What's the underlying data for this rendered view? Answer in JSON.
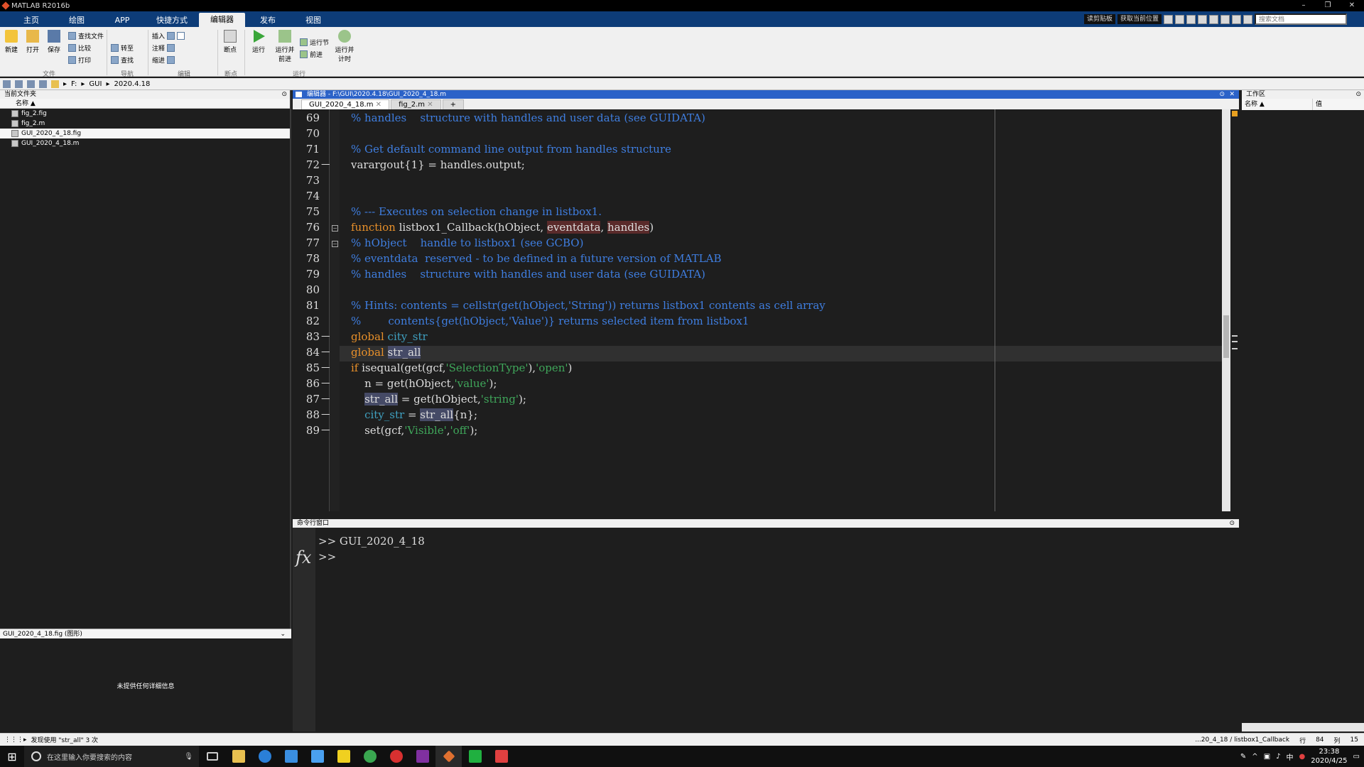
{
  "window": {
    "title": "MATLAB R2016b",
    "controls": [
      "–",
      "❐",
      "✕"
    ]
  },
  "ribbon_tabs": [
    {
      "label": "主页",
      "active": false
    },
    {
      "label": "绘图",
      "active": false
    },
    {
      "label": "APP",
      "active": false
    },
    {
      "label": "快捷方式",
      "active": false
    },
    {
      "label": "编辑器",
      "active": true
    },
    {
      "label": "发布",
      "active": false
    },
    {
      "label": "视图",
      "active": false
    }
  ],
  "quick_access": {
    "btn1": "读剪贴板",
    "btn2": "获取当前位置",
    "search_placeholder": "搜索文档"
  },
  "ribbon": {
    "new": "新建",
    "open": "打开",
    "save": "保存",
    "find_files": "查找文件",
    "compare": "比较",
    "print": "打印",
    "goto": "转至",
    "find": "查找",
    "insert": "插入",
    "comment": "注释",
    "indent": "缩进",
    "breakpoints": "断点",
    "run": "运行",
    "run_advance": "运行并前进",
    "run_section": "运行节",
    "advance": "前进",
    "run_time": "运行并计时",
    "groups": {
      "file": "文件",
      "navigate": "导航",
      "edit": "编辑",
      "breakpoints": "断点",
      "run": "运行"
    }
  },
  "address": {
    "drive": "F:",
    "folder1": "GUI",
    "folder2": "2020.4.18"
  },
  "current_folder": {
    "title": "当前文件夹",
    "column_name": "名称 ▲",
    "files": [
      {
        "name": "fig_2.fig",
        "selected": false
      },
      {
        "name": "fig_2.m",
        "selected": false
      },
      {
        "name": "GUI_2020_4_18.fig",
        "selected": true
      },
      {
        "name": "GUI_2020_4_18.m",
        "selected": false
      }
    ],
    "details_title": "GUI_2020_4_18.fig (图形)",
    "details_text": "未提供任何详细信息"
  },
  "editor": {
    "title": "编辑器 - F:\\GUI\\2020.4.18\\GUI_2020_4_18.m",
    "tabs": [
      {
        "label": "GUI_2020_4_18.m",
        "active": true
      },
      {
        "label": "fig_2.m",
        "active": false
      }
    ],
    "add_tab": "+",
    "lines": [
      {
        "n": "69",
        "dash": false,
        "segs": [
          [
            "cm",
            "% handles    structure with handles and user data (see GUIDATA)"
          ]
        ]
      },
      {
        "n": "70",
        "dash": false,
        "segs": []
      },
      {
        "n": "71",
        "dash": false,
        "segs": [
          [
            "cm",
            "% Get default command line output from handles structure"
          ]
        ]
      },
      {
        "n": "72",
        "dash": true,
        "segs": [
          [
            "",
            "varargout{1} = handles.output;"
          ]
        ]
      },
      {
        "n": "73",
        "dash": false,
        "segs": []
      },
      {
        "n": "74",
        "dash": false,
        "segs": []
      },
      {
        "n": "75",
        "dash": false,
        "segs": [
          [
            "cm",
            "% --- Executes on selection change in listbox1."
          ]
        ]
      },
      {
        "n": "76",
        "dash": false,
        "segs": [
          [
            "kw",
            "function "
          ],
          [
            "",
            "listbox1_Callback(hObject, "
          ],
          [
            "hl",
            "eventdata"
          ],
          [
            "",
            ", "
          ],
          [
            "hl",
            "handles"
          ],
          [
            "",
            ")"
          ]
        ]
      },
      {
        "n": "77",
        "dash": false,
        "segs": [
          [
            "cm",
            "% hObject    handle to listbox1 (see GCBO)"
          ]
        ]
      },
      {
        "n": "78",
        "dash": false,
        "segs": [
          [
            "cm",
            "% eventdata  reserved - to be defined in a future version of MATLAB"
          ]
        ]
      },
      {
        "n": "79",
        "dash": false,
        "segs": [
          [
            "cm",
            "% handles    structure with handles and user data (see GUIDATA)"
          ]
        ]
      },
      {
        "n": "80",
        "dash": false,
        "segs": []
      },
      {
        "n": "81",
        "dash": false,
        "segs": [
          [
            "cm",
            "% Hints: contents = cellstr(get(hObject,'String')) returns listbox1 contents as cell array"
          ]
        ]
      },
      {
        "n": "82",
        "dash": false,
        "segs": [
          [
            "cm",
            "%        contents{get(hObject,'Value')} returns selected item from listbox1"
          ]
        ]
      },
      {
        "n": "83",
        "dash": true,
        "segs": [
          [
            "kw",
            "global "
          ],
          [
            "gv",
            "city_str"
          ]
        ]
      },
      {
        "n": "84",
        "dash": true,
        "segs": [
          [
            "kw",
            "global "
          ],
          [
            "hv",
            "str_all"
          ]
        ]
      },
      {
        "n": "85",
        "dash": true,
        "segs": [
          [
            "kw",
            "if "
          ],
          [
            "",
            "isequal(get(gcf,"
          ],
          [
            "st",
            "'SelectionType'"
          ],
          [
            "",
            "),"
          ],
          [
            "st",
            "'open'"
          ],
          [
            "",
            ")"
          ]
        ]
      },
      {
        "n": "86",
        "dash": true,
        "segs": [
          [
            "",
            "    n = get(hObject,"
          ],
          [
            "st",
            "'value'"
          ],
          [
            "",
            ");"
          ]
        ]
      },
      {
        "n": "87",
        "dash": true,
        "segs": [
          [
            "",
            "    "
          ],
          [
            "hv",
            "str_all"
          ],
          [
            "",
            " = get(hObject,"
          ],
          [
            "st",
            "'string'"
          ],
          [
            "",
            ");"
          ]
        ]
      },
      {
        "n": "88",
        "dash": true,
        "segs": [
          [
            "",
            "    "
          ],
          [
            "gv",
            "city_str"
          ],
          [
            "",
            " = "
          ],
          [
            "hv",
            "str_all"
          ],
          [
            "",
            "{n};"
          ]
        ]
      },
      {
        "n": "89",
        "dash": true,
        "segs": [
          [
            "",
            "    set(gcf,"
          ],
          [
            "st",
            "'Visible'"
          ],
          [
            "",
            ","
          ],
          [
            "st",
            "'off'"
          ],
          [
            "",
            ");"
          ]
        ]
      }
    ]
  },
  "command_window": {
    "title": "命令行窗口",
    "fx": "fx",
    "line1": ">> GUI_2020_4_18",
    "line2": ">>"
  },
  "workspace": {
    "title": "工作区",
    "col_name": "名称 ▲",
    "col_value": "值"
  },
  "status": {
    "left": "发现使用 \"str_all\" 3 次",
    "func": "...20_4_18 / listbox1_Callback",
    "row_label": "行",
    "row": "84",
    "col_label": "列",
    "col": "15"
  },
  "taskbar": {
    "search_placeholder": "在这里输入你要搜索的内容",
    "time": "23:38",
    "date": "2020/4/25",
    "ime": "中"
  }
}
